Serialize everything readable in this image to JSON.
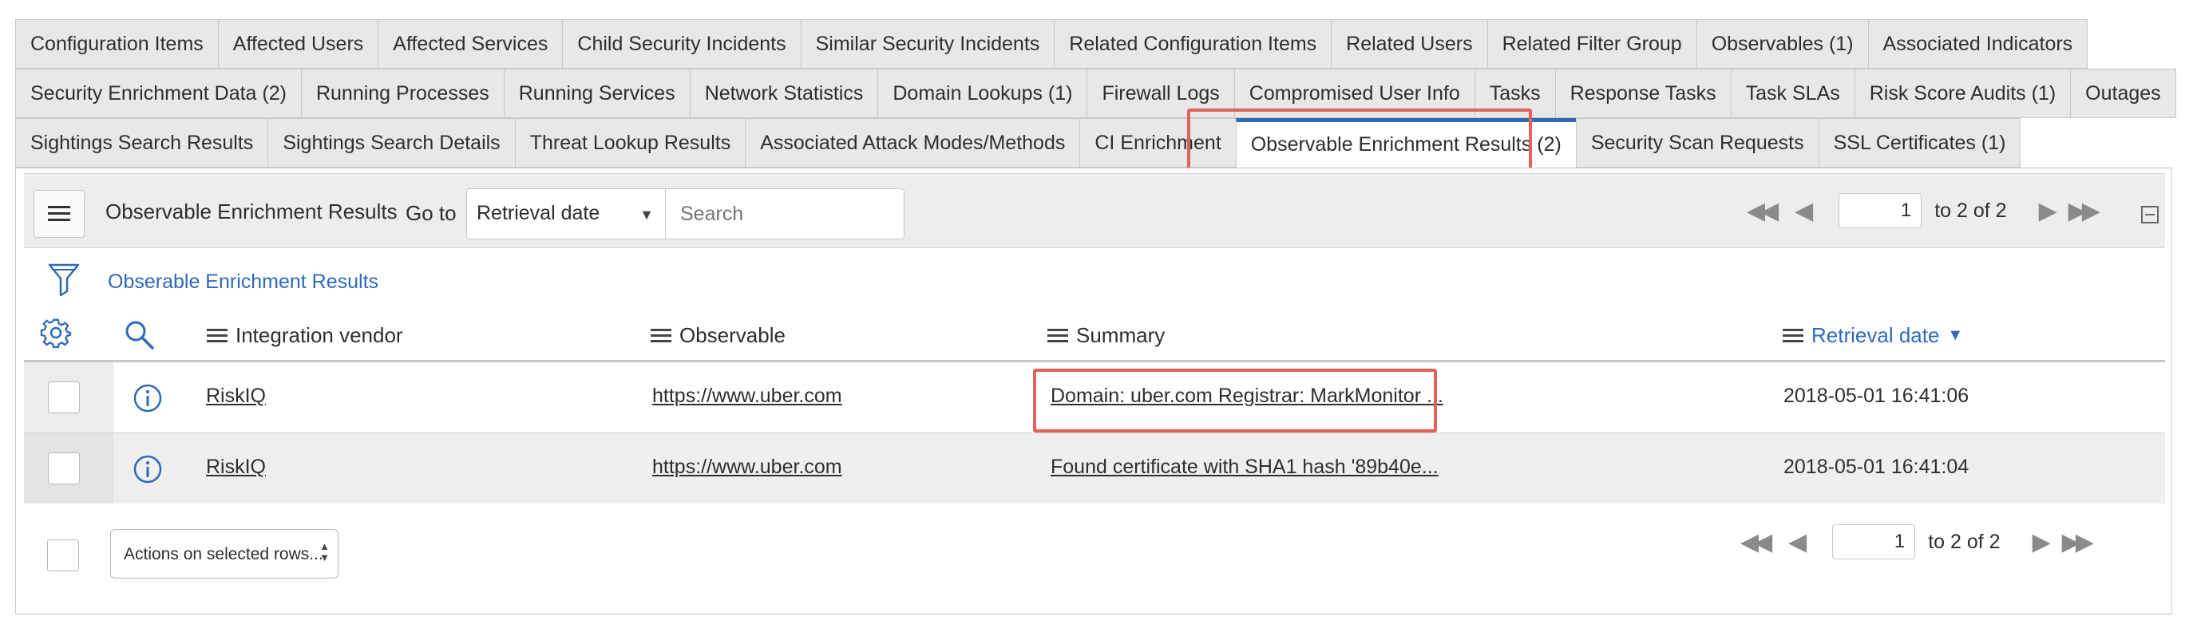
{
  "tabs": {
    "row1": [
      "Configuration Items",
      "Affected Users",
      "Affected Services",
      "Child Security Incidents",
      "Similar Security Incidents",
      "Related Configuration Items",
      "Related Users",
      "Related Filter Group",
      "Observables (1)",
      "Associated Indicators"
    ],
    "row2": [
      "Security Enrichment Data (2)",
      "Running Processes",
      "Running Services",
      "Network Statistics",
      "Domain Lookups (1)",
      "Firewall Logs",
      "Compromised User Info",
      "Tasks",
      "Response Tasks",
      "Task SLAs",
      "Risk Score Audits (1)",
      "Outages"
    ],
    "row3": [
      "Sightings Search Results",
      "Sightings Search Details",
      "Threat Lookup Results",
      "Associated Attack Modes/Methods",
      "CI Enrichment",
      "Observable Enrichment Results (2)",
      "Security Scan Requests",
      "SSL Certificates (1)"
    ],
    "active": "Observable Enrichment Results (2)"
  },
  "toolbar": {
    "title": "Observable Enrichment Results",
    "goto_label": "Go to",
    "goto_field": "Retrieval date",
    "search_placeholder": "Search",
    "page_value": "1",
    "page_of": "to 2 of 2"
  },
  "filter": {
    "label": "Obserable Enrichment Results"
  },
  "columns": {
    "vendor": "Integration vendor",
    "observable": "Observable",
    "summary": "Summary",
    "retrieval_date": "Retrieval date"
  },
  "rows": [
    {
      "vendor": "RiskIQ",
      "observable": "https://www.uber.com",
      "summary": "Domain: uber.com Registrar: MarkMonitor ...",
      "retrieval_date": "2018-05-01 16:41:06"
    },
    {
      "vendor": "RiskIQ",
      "observable": "https://www.uber.com",
      "summary": "Found certificate with SHA1 hash '89b40e...",
      "retrieval_date": "2018-05-01 16:41:04"
    }
  ],
  "footer": {
    "actions_label": "Actions on selected rows...",
    "page_value": "1",
    "page_of": "to 2 of 2"
  },
  "colors": {
    "accent": "#2f6ab7",
    "highlight": "#e0625a"
  }
}
